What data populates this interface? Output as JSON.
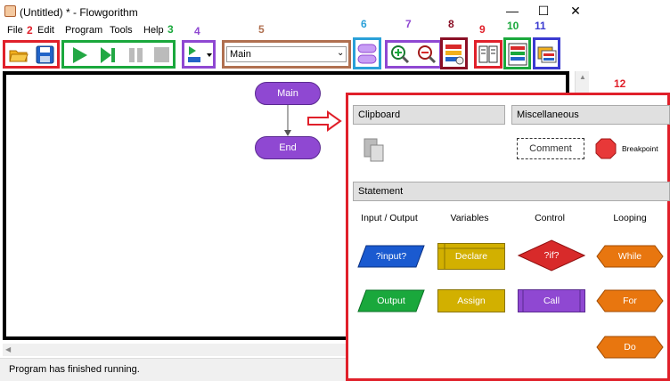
{
  "window": {
    "title": "(Untitled) * - Flowgorithm",
    "min": "—",
    "max": "☐",
    "close": "✕"
  },
  "menu": [
    "File",
    "Edit",
    "Program",
    "Tools",
    "Help"
  ],
  "toolbar": {
    "function_select": "Main"
  },
  "annotations": [
    "1",
    "2",
    "3",
    "4",
    "5",
    "6",
    "7",
    "8",
    "9",
    "10",
    "11",
    "12"
  ],
  "flowchart": {
    "start": "Main",
    "end": "End"
  },
  "status": "Program has finished running.",
  "palette": {
    "clipboard": "Clipboard",
    "misc": "Miscellaneous",
    "comment": "Comment",
    "breakpoint": "Breakpoint",
    "statement": "Statement",
    "columns": [
      "Input / Output",
      "Variables",
      "Control",
      "Looping"
    ],
    "shapes": {
      "input": "?input?",
      "output": "Output",
      "declare": "Declare",
      "assign": "Assign",
      "if": "?if?",
      "call": "Call",
      "while": "While",
      "for": "For",
      "do": "Do"
    }
  },
  "colors": {
    "purple": "#8f48d2",
    "blue": "#1a5ad0",
    "green": "#1aa83c",
    "yellow": "#d2b000",
    "red": "#d82a2a",
    "orange": "#e8760f",
    "annotation_red": "#e0202a"
  }
}
